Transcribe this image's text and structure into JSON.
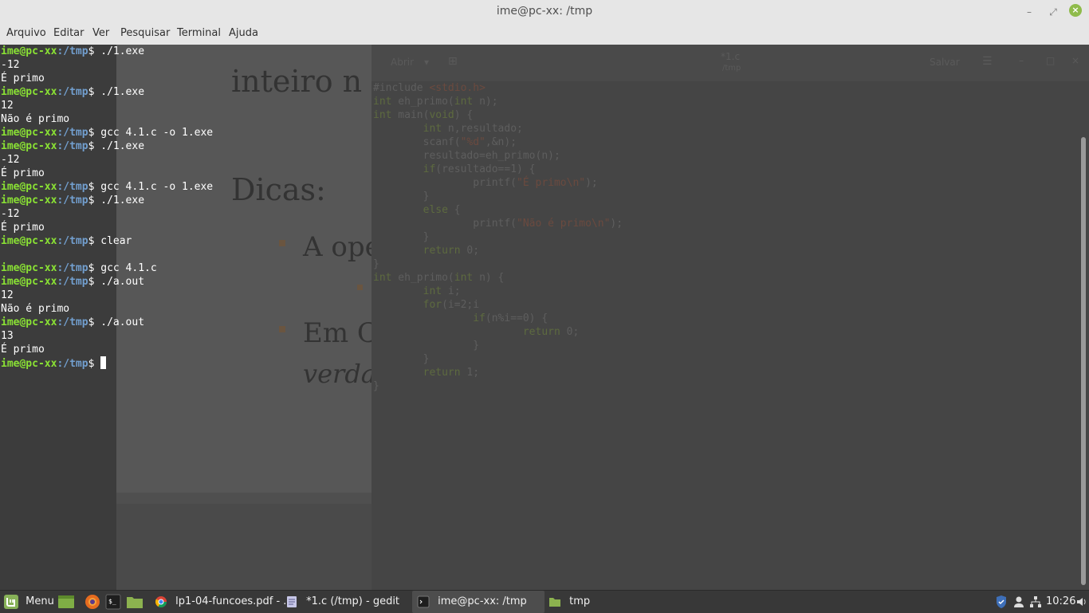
{
  "window": {
    "title": "ime@pc-xx: /tmp"
  },
  "menu": [
    "Arquivo",
    "Editar",
    "Ver",
    "Pesquisar",
    "Terminal",
    "Ajuda"
  ],
  "terminal": {
    "user_host": "ime@pc-xx",
    "path": ":/tmp",
    "lines": [
      {
        "type": "cmd",
        "text": "./1.exe"
      },
      {
        "type": "out",
        "text": "-12"
      },
      {
        "type": "out",
        "text": "É primo"
      },
      {
        "type": "cmd",
        "text": "./1.exe"
      },
      {
        "type": "out",
        "text": "12"
      },
      {
        "type": "out",
        "text": "Não é primo"
      },
      {
        "type": "cmd",
        "text": "gcc 4.1.c -o 1.exe"
      },
      {
        "type": "cmd",
        "text": "./1.exe"
      },
      {
        "type": "out",
        "text": "-12"
      },
      {
        "type": "out",
        "text": "É primo"
      },
      {
        "type": "cmd",
        "text": "gcc 4.1.c -o 1.exe"
      },
      {
        "type": "cmd",
        "text": "./1.exe"
      },
      {
        "type": "out",
        "text": "-12"
      },
      {
        "type": "out",
        "text": "É primo"
      },
      {
        "type": "cmd",
        "text": "clear"
      },
      {
        "type": "out",
        "text": ""
      },
      {
        "type": "cmd",
        "text": "gcc 4.1.c"
      },
      {
        "type": "cmd",
        "text": "./a.out"
      },
      {
        "type": "out",
        "text": "12"
      },
      {
        "type": "out",
        "text": "Não é primo"
      },
      {
        "type": "cmd",
        "text": "./a.out"
      },
      {
        "type": "out",
        "text": "13"
      },
      {
        "type": "out",
        "text": "É primo"
      },
      {
        "type": "prompt",
        "text": ""
      }
    ]
  },
  "background_pdf": {
    "heading1": "inteiro n e",
    "heading2": "Dicas:",
    "bullet1": "A ope",
    "bullet2": "Em C",
    "bullet2_italic": "verda"
  },
  "background_gedit": {
    "open_label": "Abrir",
    "tab_title": "*1.c",
    "tab_subtitle": "/tmp",
    "save_label": "Salvar",
    "code_lines": [
      "#include <stdio.h>",
      "int eh_primo(int n);",
      "int main(void) {",
      "        int n,resultado;",
      "        scanf(\"%d\",&n);",
      "        resultado=eh_primo(n);",
      "        if(resultado==1) {",
      "                printf(\"É primo\\n\");",
      "        }",
      "        else {",
      "                printf(\"Não é primo\\n\");",
      "        }",
      "        return 0;",
      "}",
      "int eh_primo(int n) {",
      "        int i;",
      "        for(i=2;i<n;i++) {",
      "                if(n%i==0) {",
      "                        return 0;",
      "                }",
      "        }",
      "        return 1;",
      "}"
    ]
  },
  "taskbar": {
    "menu_label": "Menu",
    "windows": [
      {
        "label": "lp1-04-funcoes.pdf - ...",
        "icon": "chrome-icon"
      },
      {
        "label": "*1.c (/tmp) - gedit",
        "icon": "text-editor-icon"
      },
      {
        "label": "ime@pc-xx: /tmp",
        "icon": "terminal-icon"
      },
      {
        "label": "tmp",
        "icon": "folder-icon"
      }
    ],
    "clock": "10:26"
  }
}
